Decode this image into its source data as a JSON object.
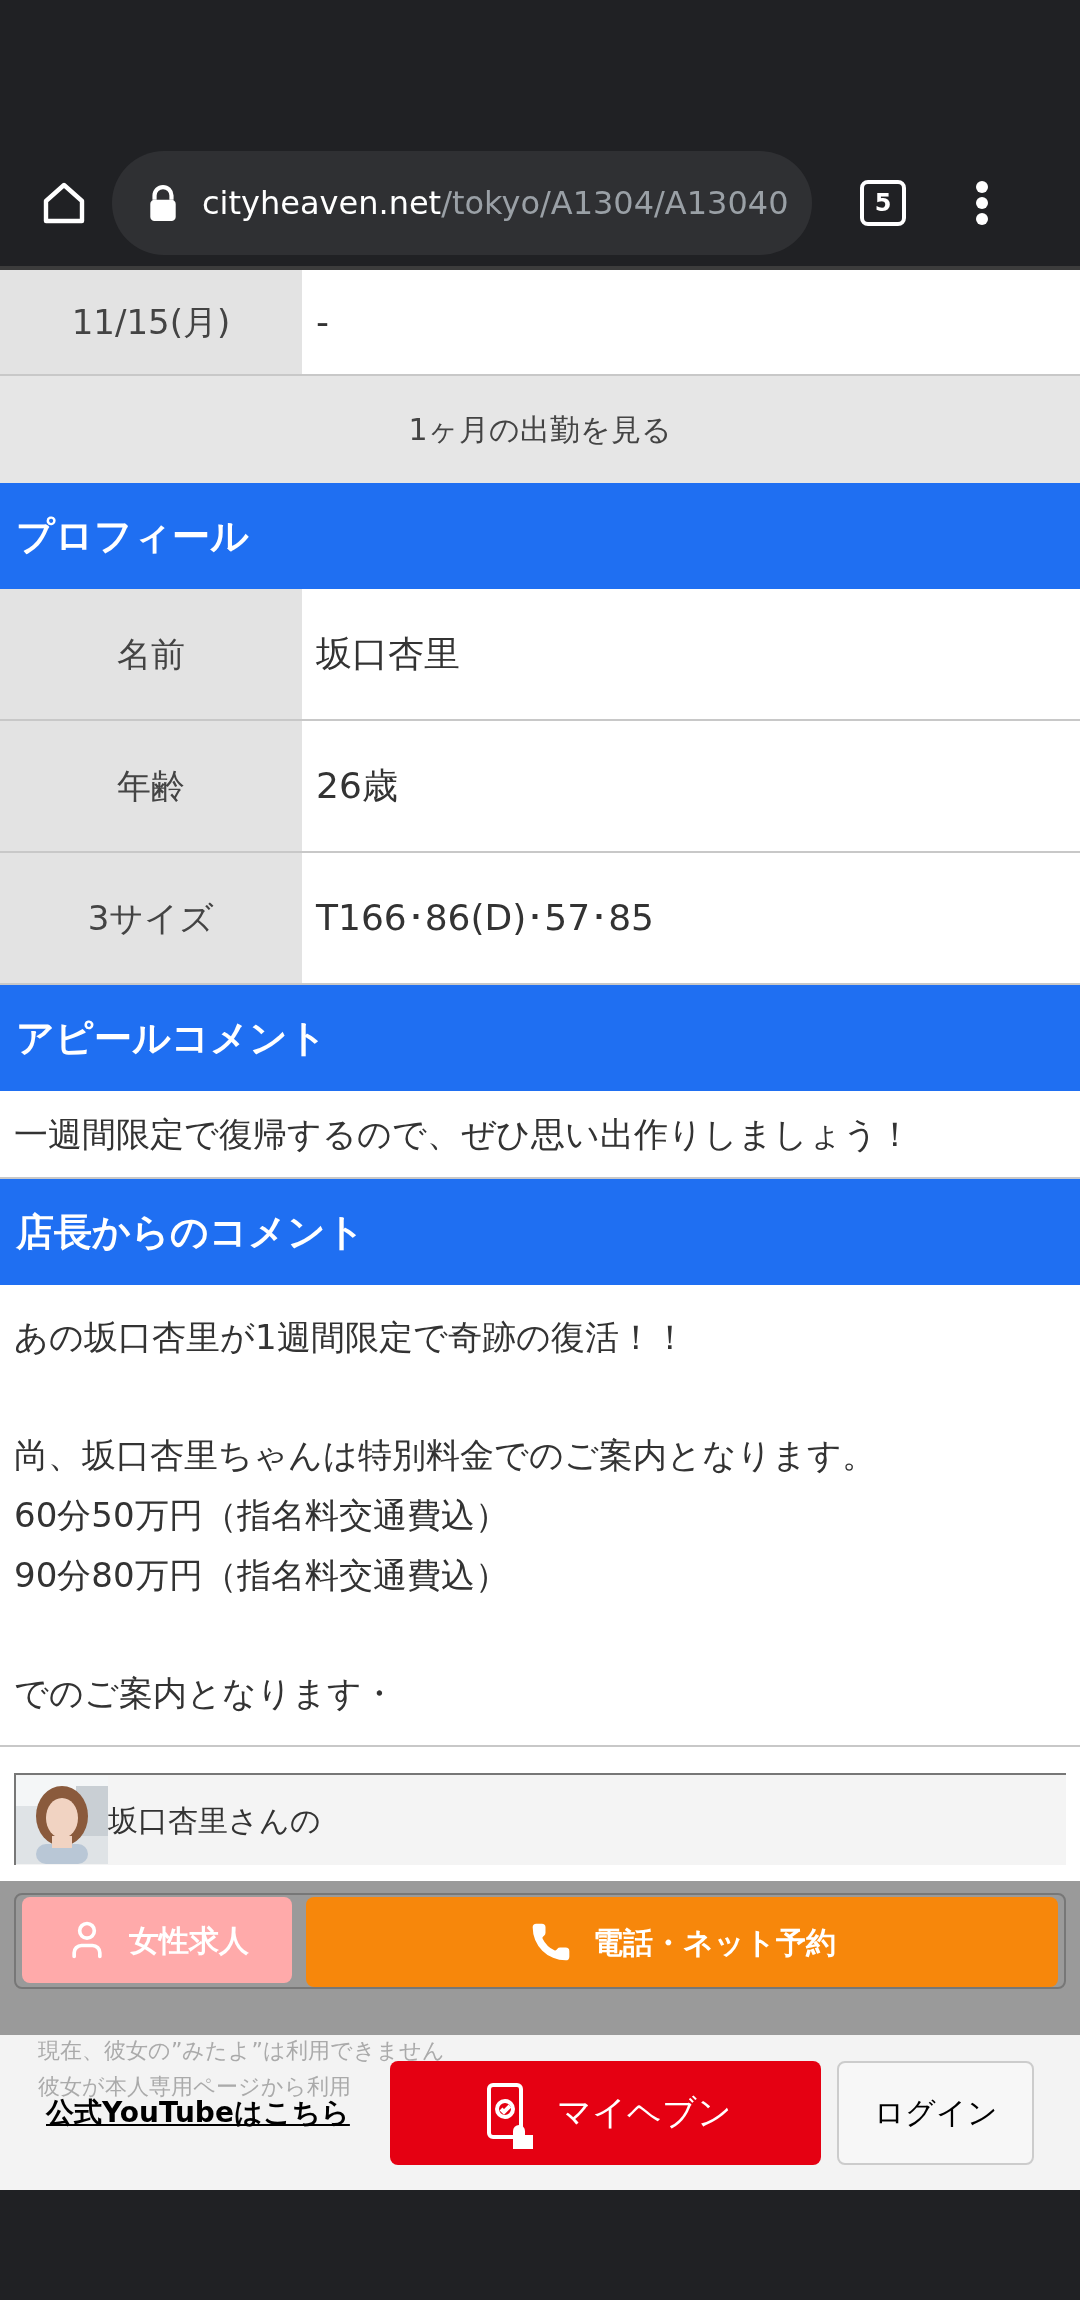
{
  "browser": {
    "url_host": "cityheaven.net",
    "url_path": "/tokyo/A1304/A13040",
    "tab_count": "5"
  },
  "schedule": {
    "rows": [
      {
        "date": "11/15(月)",
        "value": "-"
      }
    ],
    "more_link": "1ヶ月の出勤を見る"
  },
  "profile": {
    "title": "プロフィール",
    "rows": [
      {
        "label": "名前",
        "value": "坂口杏里"
      },
      {
        "label": "年齢",
        "value": "26歳"
      },
      {
        "label": "3サイズ",
        "value": "T166･86(D)･57･85"
      }
    ]
  },
  "appeal": {
    "title": "アピールコメント",
    "text": "一週間限定で復帰するので、ぜひ思い出作りしましょう！"
  },
  "manager_comment": {
    "title": "店長からのコメント",
    "paragraphs": [
      [
        "あの坂口杏里が1週間限定で奇跡の復活！！"
      ],
      [
        "尚、坂口杏里ちゃんは特別料金でのご案内となります。",
        "60分50万円（指名料交通費込）",
        "90分80万円（指名料交通費込）"
      ],
      [
        "でのご案内となります・"
      ]
    ]
  },
  "card": {
    "text": "坂口杏里さんの"
  },
  "action_bar": {
    "buttons": [
      {
        "kind": "recruit",
        "label": "女性求人"
      },
      {
        "kind": "reserve",
        "label": "電話・ネット予約"
      }
    ]
  },
  "notice": {
    "lines": [
      "現在、彼女の”みたよ”は利用できません",
      "彼女が本人専用ページから利用"
    ]
  },
  "footer": {
    "link": "公式YouTubeはこちら",
    "buttons": [
      {
        "kind": "myheaven",
        "label": "マイヘブン"
      },
      {
        "kind": "login",
        "label": "ログイン"
      }
    ]
  }
}
